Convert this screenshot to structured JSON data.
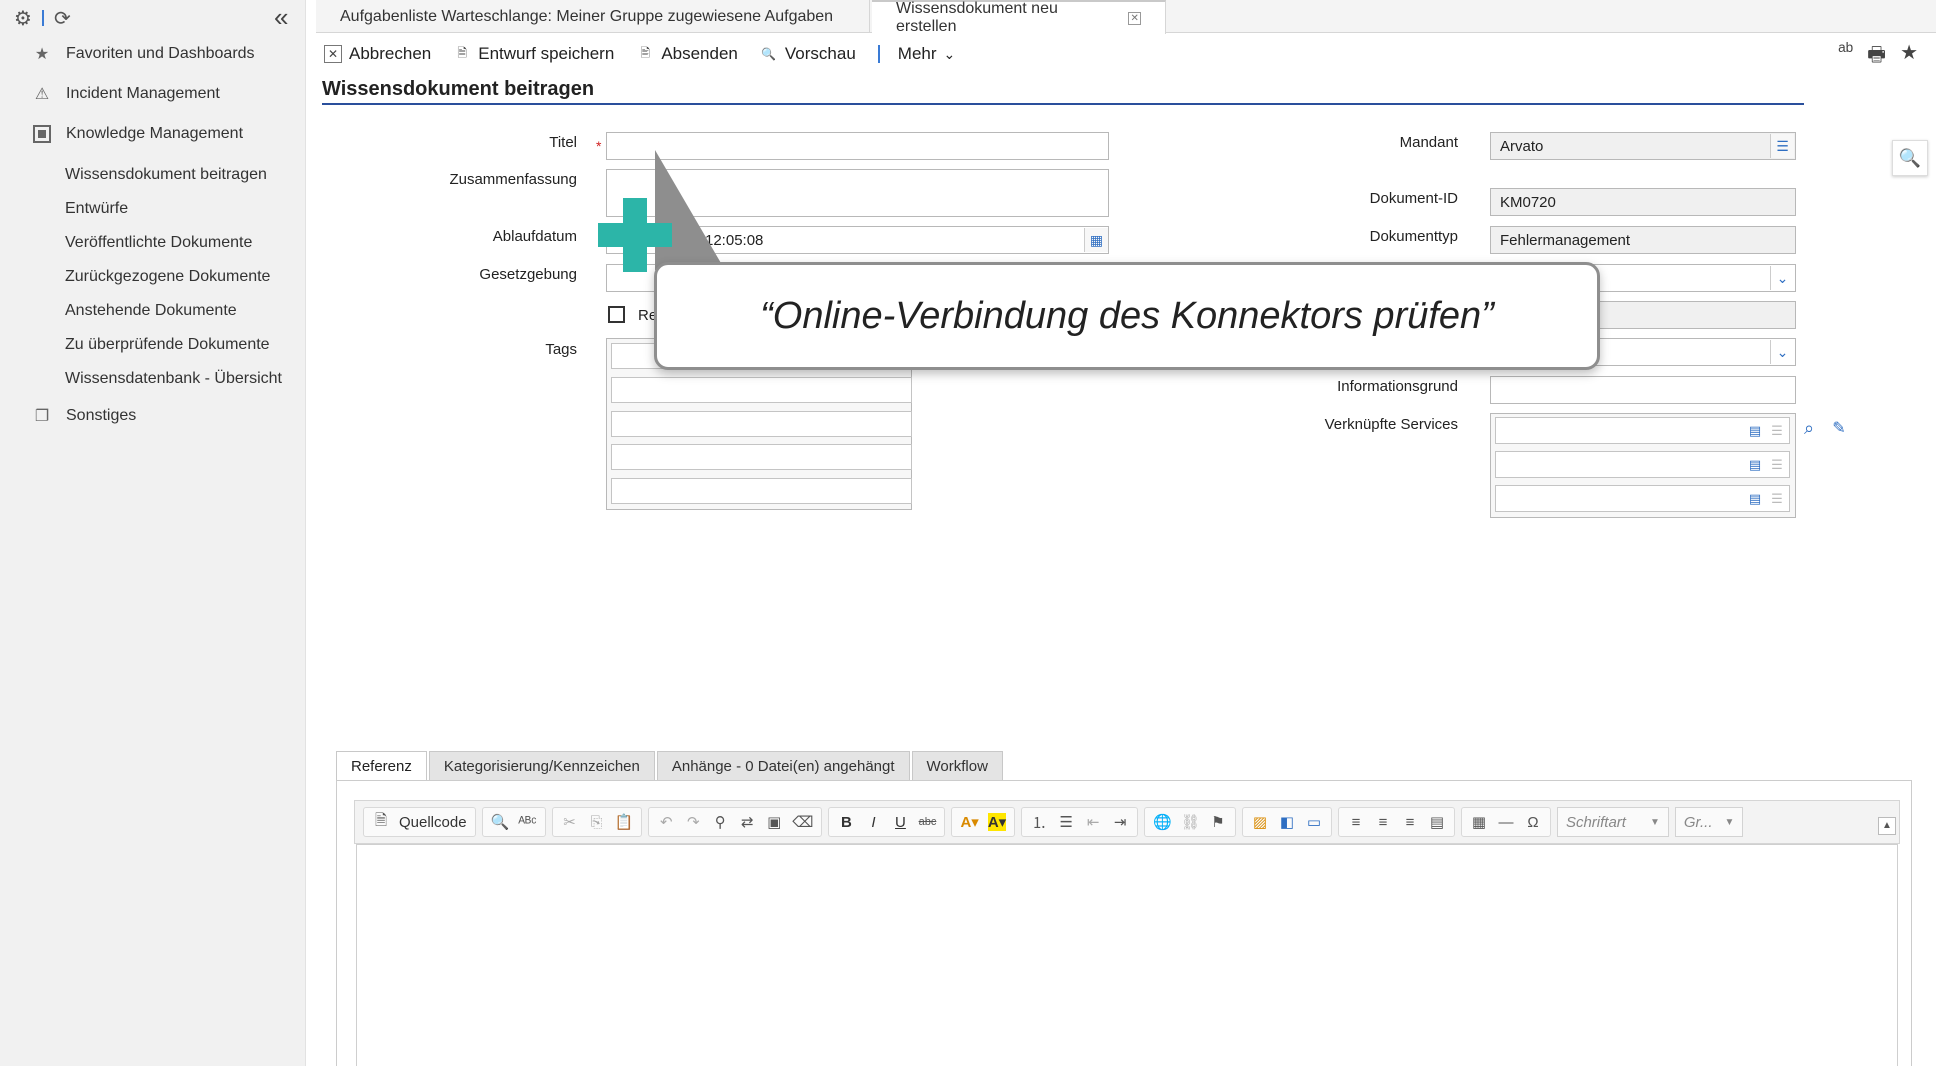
{
  "sidebar": {
    "nav": [
      {
        "label": "Favoriten und Dashboards",
        "icon": "star-icon"
      },
      {
        "label": "Incident Management",
        "icon": "warning-icon"
      },
      {
        "label": "Knowledge Management",
        "icon": "book-icon"
      }
    ],
    "sub_items": [
      "Wissensdokument beitragen",
      "Entwürfe",
      "Veröffentlichte Dokumente",
      "Zurückgezogene Dokumente",
      "Anstehende Dokumente",
      "Zu überprüfende Dokumente",
      "Wissensdatenbank - Übersicht"
    ],
    "other": {
      "label": "Sonstiges",
      "icon": "folder-icon"
    }
  },
  "tabs": [
    {
      "label": "Aufgabenliste Warteschlange: Meiner Gruppe zugewiesene Aufgaben",
      "active": false
    },
    {
      "label": "Wissensdokument neu erstellen",
      "active": true
    }
  ],
  "toolbar": {
    "cancel": "Abbrechen",
    "save_draft": "Entwurf speichern",
    "submit": "Absenden",
    "preview": "Vorschau",
    "more": "Mehr"
  },
  "page_title": "Wissensdokument beitragen",
  "form": {
    "labels": {
      "title": "Titel",
      "summary": "Zusammenfassung",
      "expiry": "Ablaufdatum",
      "legislation": "Gesetzgebung",
      "tags": "Tags",
      "tenant": "Mandant",
      "doc_id": "Dokument-ID",
      "doc_type": "Dokumenttyp",
      "info_reason": "Informationsgrund",
      "linked_services": "Verknüpfte Services"
    },
    "values": {
      "title": "",
      "summary": "",
      "expiry_partial": "12:05:08",
      "tenant": "Arvato",
      "doc_id": "KM0720",
      "doc_type": "Fehlermanagement",
      "checkbox_partial": "Re"
    }
  },
  "callout": {
    "text": "“Online-Verbindung des Konnektors prüfen”",
    "accent": "#2cb5a8"
  },
  "bottom_tabs": [
    {
      "label": "Referenz",
      "active": true
    },
    {
      "label": "Kategorisierung/Kennzeichen",
      "active": false
    },
    {
      "label": "Anhänge - 0 Datei(en) angehängt",
      "active": false
    },
    {
      "label": "Workflow",
      "active": false
    }
  ],
  "editor": {
    "source_label": "Quellcode",
    "font_placeholder": "Schriftart",
    "size_placeholder": "Gr..."
  }
}
